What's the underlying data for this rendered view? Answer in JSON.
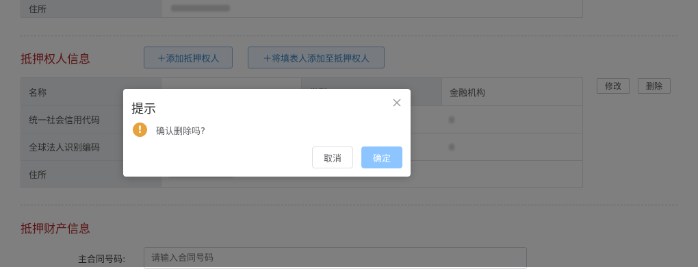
{
  "prev_table": {
    "address_label": "住所"
  },
  "mortgagee": {
    "section_title": "抵押权人信息",
    "add_button": "＋添加抵押权人",
    "add_filler_button": "＋将填表人添加至抵押权人",
    "rows": [
      {
        "label": "名称",
        "type_label": "类型",
        "type_value": "金融机构"
      },
      {
        "label": "统一社会信用代码"
      },
      {
        "label": "全球法人识别编码"
      },
      {
        "label": "住所"
      }
    ],
    "edit_button": "修改",
    "delete_button": "删除"
  },
  "property": {
    "section_title": "抵押财产信息",
    "contract_label": "主合同号码:",
    "contract_placeholder": "请输入合同号码"
  },
  "dialog": {
    "title": "提示",
    "message": "确认删除吗?",
    "cancel_label": "取消",
    "confirm_label": "确定",
    "icon": "warning-icon",
    "warning_color": "#e6a23c",
    "confirm_color": "#8cc5ff"
  }
}
